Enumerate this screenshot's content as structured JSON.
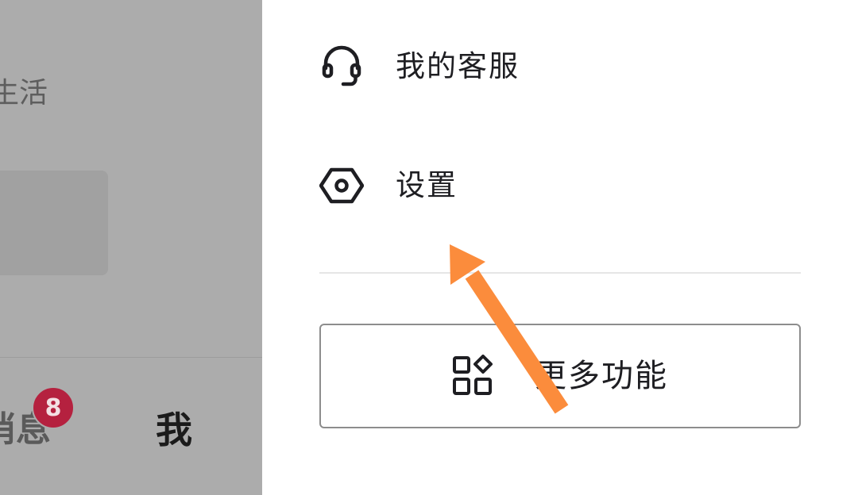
{
  "background_page": {
    "partial_text": "生活",
    "tabs": [
      {
        "label": "消息",
        "badge": "8"
      },
      {
        "label": "我"
      }
    ]
  },
  "drawer": {
    "items": [
      {
        "label": "我的客服",
        "icon": "headset-icon"
      },
      {
        "label": "设置",
        "icon": "settings-hexagon-icon"
      }
    ],
    "more_button": {
      "label": "更多功能",
      "icon": "grid-apps-icon"
    }
  },
  "annotation": {
    "icon": "arrow-icon",
    "color": "#fb8c3c"
  },
  "colors": {
    "overlay": "#acacac",
    "badge": "#b5213f",
    "text_primary": "#1e1e22",
    "divider": "#e6e6e6",
    "button_border": "#8d8d8d"
  }
}
